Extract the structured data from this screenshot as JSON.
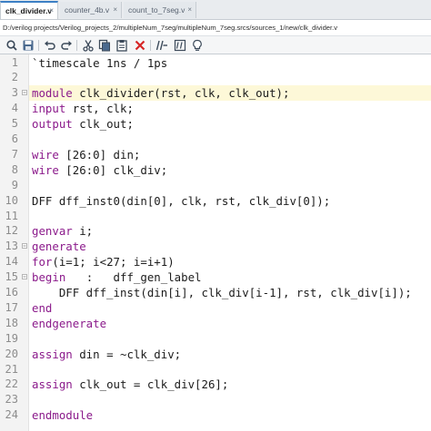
{
  "tabs": [
    {
      "label": "clk_divider.v",
      "active": true
    },
    {
      "label": "counter_4b.v",
      "active": false
    },
    {
      "label": "count_to_7seg.v",
      "active": false
    }
  ],
  "tab_close_glyph": "×",
  "file_path": "D:/verilog projects/Verilog_projects_2/multipleNum_7seg/multipleNum_7seg.srcs/sources_1/new/clk_divider.v",
  "toolbar_icons": [
    "search-icon",
    "save-icon",
    "undo-icon",
    "redo-icon",
    "cut-icon",
    "copy-icon",
    "paste-icon",
    "delete-icon",
    "comment-icon",
    "block-comment-icon",
    "lightbulb-icon"
  ],
  "highlight_line": 3,
  "colors": {
    "keyword": "#8b1a8b",
    "current_line": "#fdf8d8",
    "gutter": "#f3f3f3",
    "active_tab_accent": "#3b7fc4"
  },
  "code_lines": [
    {
      "n": "1",
      "text": "`timescale 1ns / 1ps",
      "keywords": []
    },
    {
      "n": "2",
      "text": "",
      "keywords": []
    },
    {
      "n": "3",
      "text": "module clk_divider(rst, clk, clk_out);",
      "keywords": [
        "module"
      ]
    },
    {
      "n": "4",
      "text": "input rst, clk;",
      "keywords": [
        "input"
      ]
    },
    {
      "n": "5",
      "text": "output clk_out;",
      "keywords": [
        "output"
      ]
    },
    {
      "n": "6",
      "text": "",
      "keywords": []
    },
    {
      "n": "7",
      "text": "wire [26:0] din;",
      "keywords": [
        "wire"
      ]
    },
    {
      "n": "8",
      "text": "wire [26:0] clk_div;",
      "keywords": [
        "wire"
      ]
    },
    {
      "n": "9",
      "text": "",
      "keywords": []
    },
    {
      "n": "10",
      "text": "DFF dff_inst0(din[0], clk, rst, clk_div[0]);",
      "keywords": []
    },
    {
      "n": "11",
      "text": "",
      "keywords": []
    },
    {
      "n": "12",
      "text": "genvar i;",
      "keywords": [
        "genvar"
      ]
    },
    {
      "n": "13",
      "text": "generate",
      "keywords": [
        "generate"
      ]
    },
    {
      "n": "14",
      "text": "for(i=1; i<27; i=i+1)",
      "keywords": [
        "for"
      ]
    },
    {
      "n": "15",
      "text": "begin   :   dff_gen_label",
      "keywords": [
        "begin"
      ]
    },
    {
      "n": "16",
      "text": "    DFF dff_inst(din[i], clk_div[i-1], rst, clk_div[i]);",
      "keywords": []
    },
    {
      "n": "17",
      "text": "end",
      "keywords": [
        "end"
      ]
    },
    {
      "n": "18",
      "text": "endgenerate",
      "keywords": [
        "endgenerate"
      ]
    },
    {
      "n": "19",
      "text": "",
      "keywords": []
    },
    {
      "n": "20",
      "text": "assign din = ~clk_div;",
      "keywords": [
        "assign"
      ]
    },
    {
      "n": "21",
      "text": "",
      "keywords": []
    },
    {
      "n": "22",
      "text": "assign clk_out = clk_div[26];",
      "keywords": [
        "assign"
      ]
    },
    {
      "n": "23",
      "text": "",
      "keywords": []
    },
    {
      "n": "24",
      "text": "endmodule",
      "keywords": [
        "endmodule"
      ]
    }
  ]
}
